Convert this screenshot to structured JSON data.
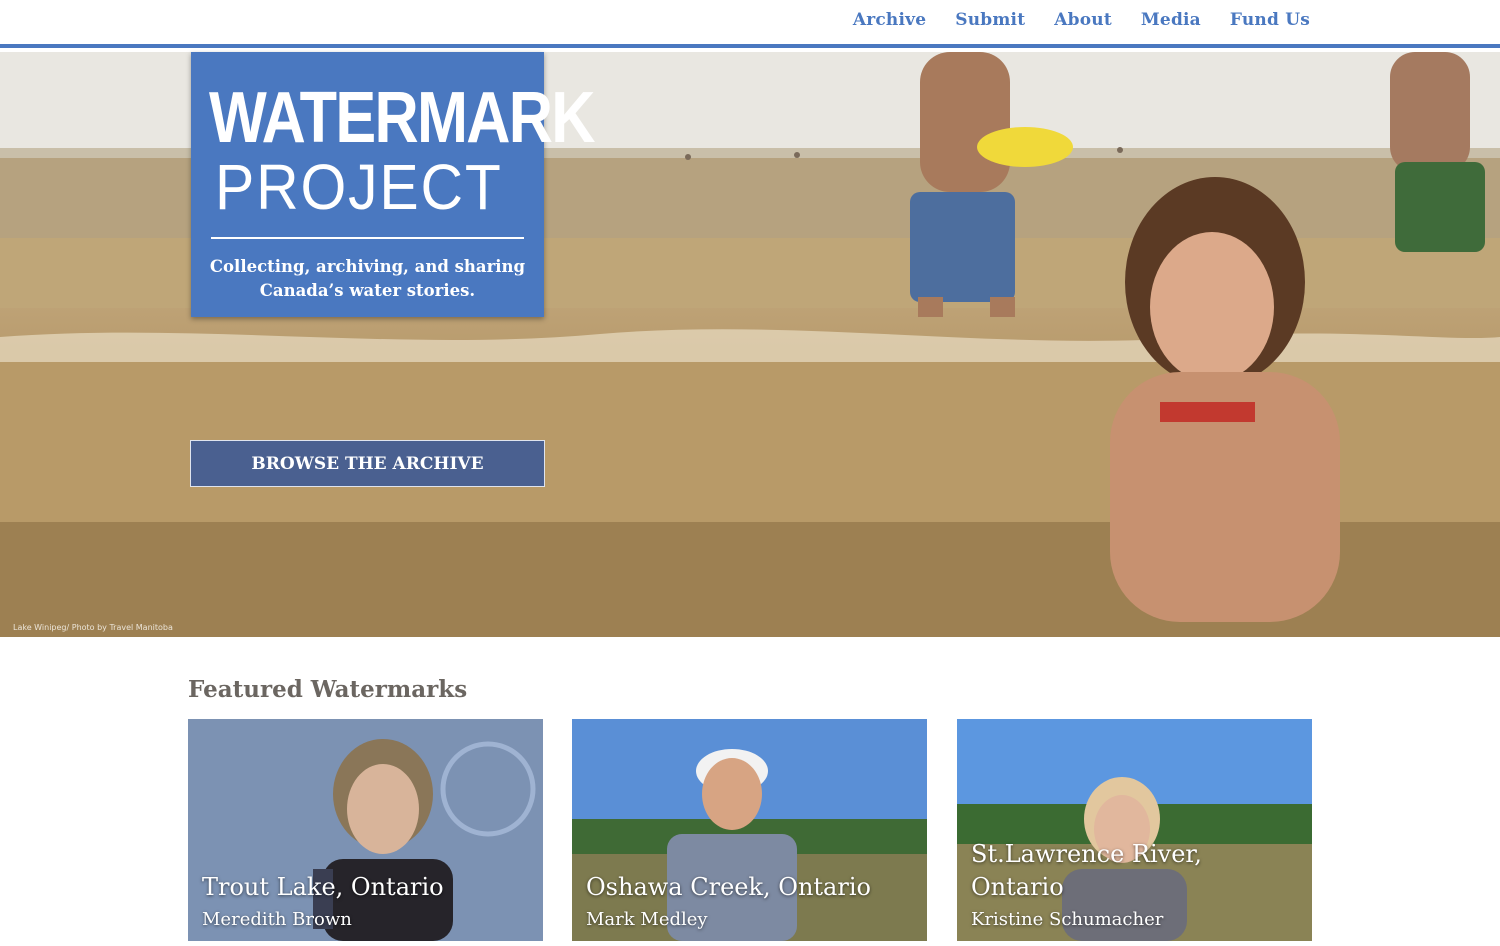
{
  "nav": {
    "items": [
      {
        "label": "Archive"
      },
      {
        "label": "Submit"
      },
      {
        "label": "About"
      },
      {
        "label": "Media"
      },
      {
        "label": "Fund Us"
      }
    ]
  },
  "hero": {
    "logo_line1": "WATERMARK",
    "logo_line2": "PROJECT",
    "tagline": "Collecting, archiving, and sharing Canada’s water stories.",
    "browse_label": "BROWSE THE ARCHIVE",
    "photo_credit": "Lake Winipeg/ Photo by Travel Manitoba"
  },
  "featured": {
    "title": "Featured Watermarks",
    "cards": [
      {
        "place": "Trout Lake, Ontario",
        "person": "Meredith Brown"
      },
      {
        "place": "Oshawa Creek, Ontario",
        "person": "Mark Medley"
      },
      {
        "place": "St.Lawrence River, Ontario",
        "person": "Kristine Schumacher"
      }
    ]
  },
  "colors": {
    "brand_blue": "#4a78c0",
    "button_bg": "#4a6090",
    "heading_gray": "#6b6661"
  },
  "icons": {
    "logo": "watermark-project-logo"
  }
}
